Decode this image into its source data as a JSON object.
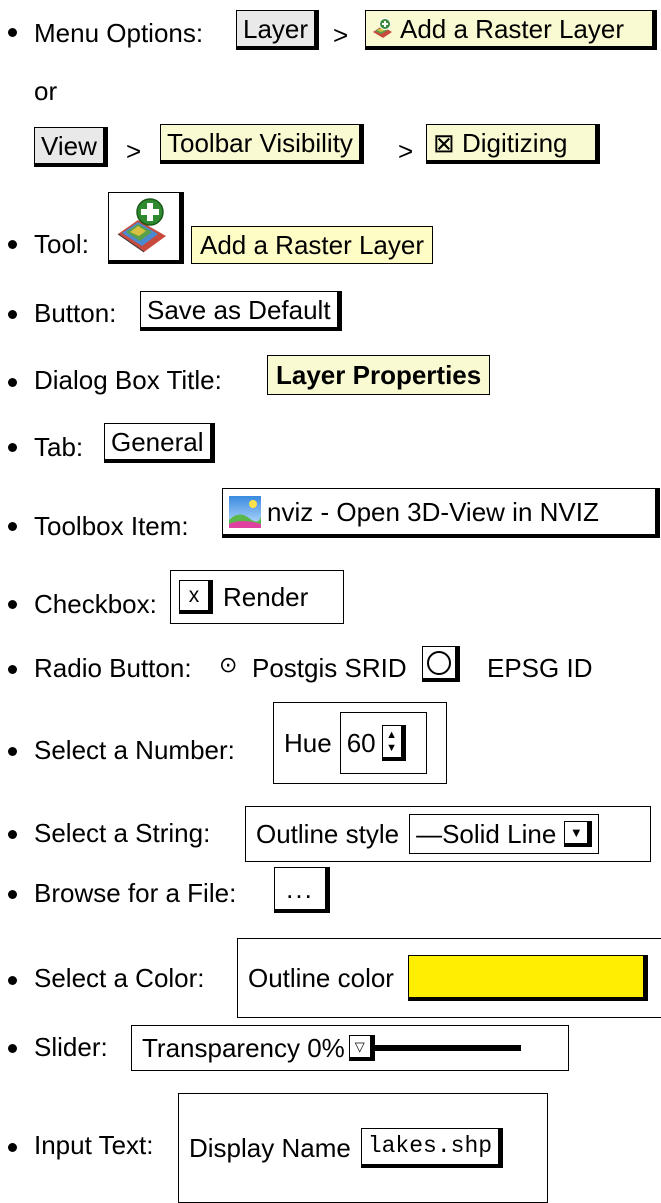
{
  "menu_options": {
    "label": "Menu Options:",
    "layer_menu": "Layer",
    "sep1": ">",
    "add_raster": "Add a Raster Layer",
    "or": "or",
    "view_menu": "View",
    "sep2": ">",
    "toolbar_visibility": "Toolbar Visibility",
    "sep3": ">",
    "digitizing": "⊠ Digitizing"
  },
  "tool": {
    "label": "Tool:",
    "tooltip": "Add a Raster Layer"
  },
  "button": {
    "label": "Button:",
    "text": "Save as Default"
  },
  "dialog": {
    "label": "Dialog Box Title:",
    "title": "Layer Properties"
  },
  "tab": {
    "label": "Tab:",
    "text": "General"
  },
  "toolbox": {
    "label": "Toolbox Item:",
    "text": "nviz - Open 3D-View in NVIZ"
  },
  "checkbox": {
    "label": "Checkbox:",
    "mark": "x",
    "text": "Render"
  },
  "radio": {
    "label": "Radio Button:",
    "symbol": "⊙",
    "opt1": "Postgis SRID",
    "opt2": "EPSG ID"
  },
  "number": {
    "label": "Select a Number:",
    "field": "Hue",
    "value": "60"
  },
  "string": {
    "label": "Select a String:",
    "field": "Outline style",
    "value": "—Solid Line"
  },
  "file": {
    "label": "Browse for a File:",
    "text": "..."
  },
  "color": {
    "label": "Select a Color:",
    "field": "Outline color",
    "swatch": "#ffee00"
  },
  "slider": {
    "label": "Slider:",
    "text": "Transparency 0%",
    "value": 0
  },
  "input": {
    "label": "Input Text:",
    "field": "Display Name",
    "value": "lakes.shp"
  }
}
